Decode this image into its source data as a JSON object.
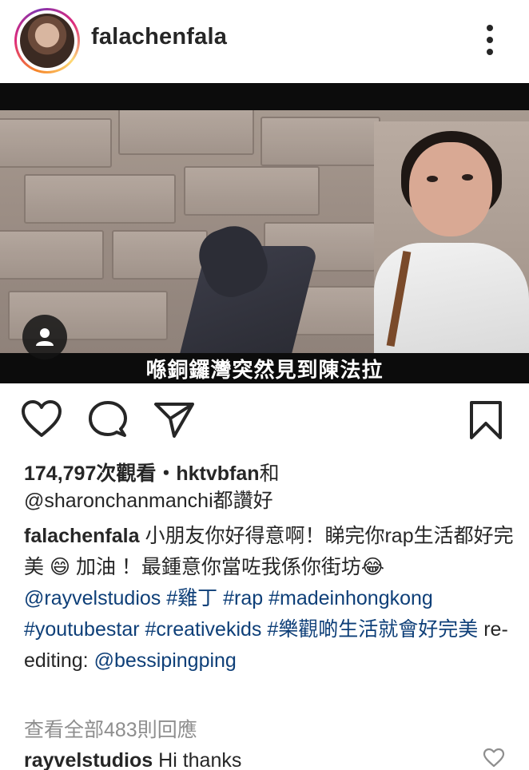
{
  "header": {
    "username": "falachenfala"
  },
  "media": {
    "subtitle": "喺銅鑼灣突然見到陳法拉"
  },
  "stats": {
    "views_count": "174,797次觀看",
    "liked_by_text": "・hktvbfan",
    "and_text": "和",
    "second_user": "@sharonchanmanchi",
    "praise_text": "都讚好"
  },
  "caption": {
    "author": "falachenfala",
    "text_1": " 小朋友你好得意啊！睇完你rap生活都好完美 ",
    "emoji_1": "😄",
    "text_2": " 加油 ！最鍾意你當咗我係你街坊",
    "emoji_2": "😂",
    "mention_1": "@rayvelstudios",
    "hashtag_1": "#雞丁",
    "hashtag_2": "#rap",
    "hashtag_3": "#madeinhongkong",
    "hashtag_4": "#youtubestar",
    "hashtag_5": "#creativekids",
    "hashtag_6": "#樂觀啲生活就會好完美",
    "text_3": " re-editing: ",
    "mention_2": "@bessipingping"
  },
  "comments": {
    "view_all": "查看全部483則回應",
    "first": {
      "author": "rayvelstudios",
      "text": " Hi thanks"
    }
  },
  "icons": {
    "more": "more-vertical-icon",
    "like": "heart-icon",
    "comment": "comment-icon",
    "share": "paper-plane-icon",
    "save": "bookmark-icon",
    "user_tag": "person-icon"
  },
  "colors": {
    "text": "#262626",
    "hashtag": "#0e3f78",
    "muted": "#8e8e8e"
  }
}
